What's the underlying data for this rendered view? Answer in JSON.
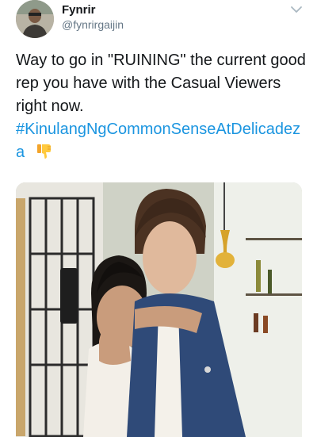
{
  "author": {
    "display_name": "Fynrir",
    "handle": "@fynrirgaijin",
    "avatar_icon": "profile-photo"
  },
  "tweet": {
    "text_lines": [
      "Way to go in \"RUINING\" the current good",
      "rep you have with the Casual Viewers",
      "right now."
    ],
    "hashtag_head": "#KinulangNgCommonSenseAtDelicadez",
    "hashtag_tail": "a",
    "emoji": "thumbs-down-icon"
  },
  "media": {
    "type": "photo",
    "description_icon": "photo-image"
  },
  "colors": {
    "link": "#1b95e0",
    "text": "#14171a",
    "secondary": "#657786"
  }
}
